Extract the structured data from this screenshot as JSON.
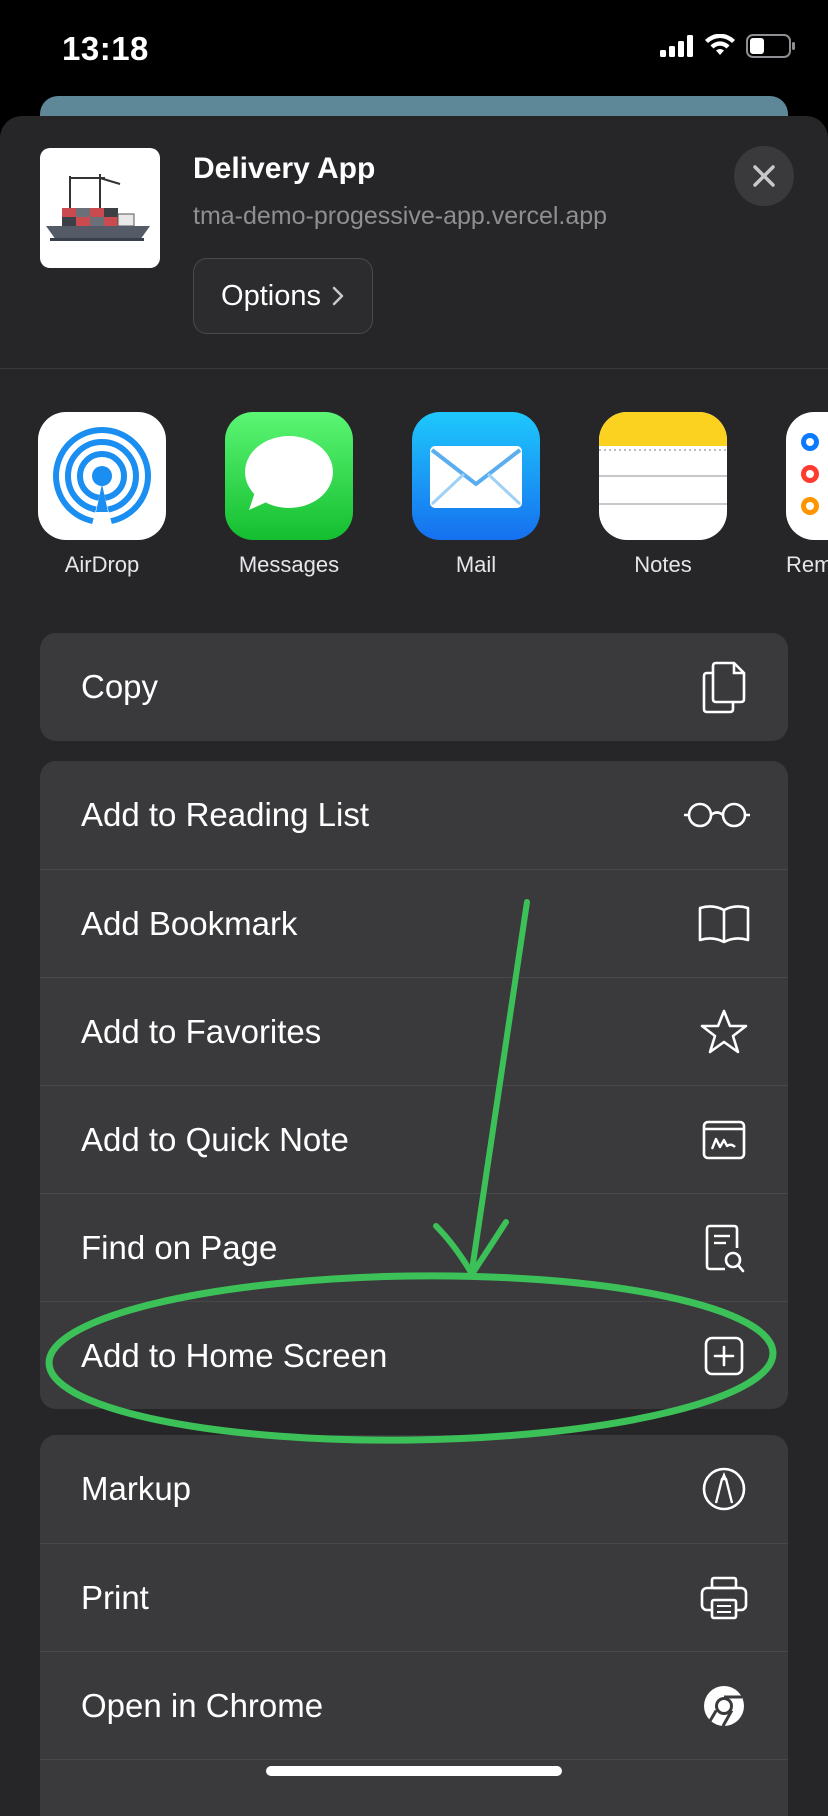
{
  "status_bar": {
    "time": "13:18"
  },
  "header": {
    "app_name": "Delivery App",
    "app_url": "tma-demo-progessive-app.vercel.app",
    "options_label": "Options",
    "close_icon": "close-icon"
  },
  "share_targets": [
    {
      "label": "AirDrop",
      "icon": "airdrop-icon"
    },
    {
      "label": "Messages",
      "icon": "messages-icon"
    },
    {
      "label": "Mail",
      "icon": "mail-icon"
    },
    {
      "label": "Notes",
      "icon": "notes-icon"
    },
    {
      "label": "Rem",
      "icon": "reminders-icon"
    }
  ],
  "groups": [
    {
      "actions": [
        {
          "label": "Copy",
          "icon": "copy-icon"
        }
      ]
    },
    {
      "actions": [
        {
          "label": "Add to Reading List",
          "icon": "glasses-icon"
        },
        {
          "label": "Add Bookmark",
          "icon": "book-icon"
        },
        {
          "label": "Add to Favorites",
          "icon": "star-icon"
        },
        {
          "label": "Add to Quick Note",
          "icon": "quick-note-icon"
        },
        {
          "label": "Find on Page",
          "icon": "find-on-page-icon"
        },
        {
          "label": "Add to Home Screen",
          "icon": "add-square-icon"
        }
      ]
    },
    {
      "actions": [
        {
          "label": "Markup",
          "icon": "markup-icon"
        },
        {
          "label": "Print",
          "icon": "printer-icon"
        },
        {
          "label": "Open in Chrome",
          "icon": "chrome-icon"
        }
      ]
    }
  ],
  "annotation": {
    "color": "#3cc158",
    "shapes": [
      "arrow",
      "ellipse"
    ]
  }
}
